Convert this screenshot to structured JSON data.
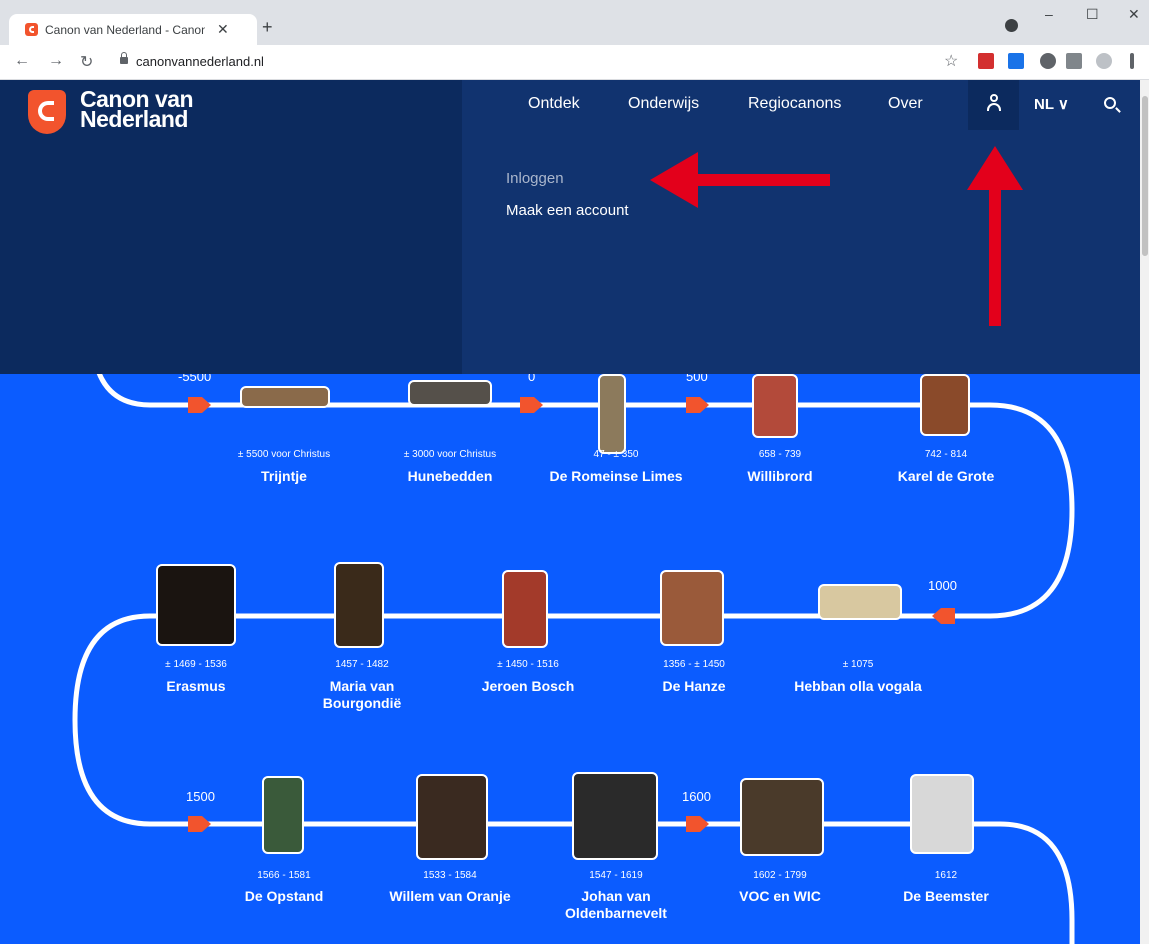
{
  "browser": {
    "tab_title": "Canon van Nederland - Canon va",
    "tab_close": "✕",
    "new_tab": "+",
    "url": "canonvannederland.nl",
    "window_controls": [
      "–",
      "☐",
      "✕"
    ]
  },
  "header": {
    "logo_line1": "Canon van",
    "logo_line2": "Nederland",
    "nav": [
      "Ontdek",
      "Onderwijs",
      "Regiocanons",
      "Over"
    ],
    "lang": "NL ∨"
  },
  "account_menu": {
    "login": "Inloggen",
    "create": "Maak een account"
  },
  "timeline": {
    "years": [
      "-5500",
      "0",
      "500",
      "1000",
      "1500",
      "1600"
    ],
    "items": [
      {
        "date": "± 5500 voor Christus",
        "name": "Trijntje"
      },
      {
        "date": "± 3000 voor Christus",
        "name": "Hunebedden"
      },
      {
        "date": "47 - ± 350",
        "name": "De Romeinse Limes"
      },
      {
        "date": "658 - 739",
        "name": "Willibrord"
      },
      {
        "date": "742 - 814",
        "name": "Karel de Grote"
      },
      {
        "date": "± 1469 - 1536",
        "name": "Erasmus"
      },
      {
        "date": "1457 - 1482",
        "name": "Maria van",
        "name2": "Bourgondië"
      },
      {
        "date": "± 1450 - 1516",
        "name": "Jeroen Bosch"
      },
      {
        "date": "1356 - ± 1450",
        "name": "De Hanze"
      },
      {
        "date": "± 1075",
        "name": "Hebban olla vogala"
      },
      {
        "date": "1566 - 1581",
        "name": "De Opstand"
      },
      {
        "date": "1533 - 1584",
        "name": "Willem van Oranje"
      },
      {
        "date": "1547 - 1619",
        "name": "Johan van",
        "name2": "Oldenbarnevelt"
      },
      {
        "date": "1602 - 1799",
        "name": "VOC en WIC"
      },
      {
        "date": "1612",
        "name": "De Beemster"
      }
    ]
  },
  "colors": {
    "page_bg": "#0b5cff",
    "header_left": "#0c2a5e",
    "header_right": "#11336f",
    "accent": "#f2542d",
    "arrow": "#e3001b"
  }
}
